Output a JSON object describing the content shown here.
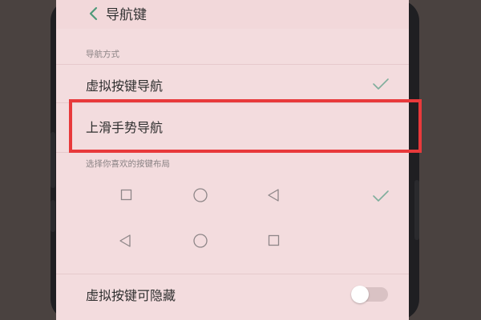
{
  "header": {
    "title": "导航键"
  },
  "nav_mode": {
    "section_label": "导航方式",
    "options": [
      {
        "label": "虚拟按键导航",
        "selected": true
      },
      {
        "label": "上滑手势导航",
        "selected": false
      }
    ]
  },
  "layout": {
    "section_label": "选择你喜欢的按键布局",
    "rows": [
      {
        "keys": [
          "square-icon",
          "circle-icon",
          "back-triangle-icon"
        ],
        "selected": true
      },
      {
        "keys": [
          "back-triangle-icon",
          "circle-icon",
          "square-icon"
        ],
        "selected": false
      }
    ]
  },
  "hide_keys": {
    "label": "虚拟按键可隐藏",
    "enabled": false
  },
  "colors": {
    "accent_check": "#7fae9c",
    "highlight_box": "#e8393b",
    "screen_bg": "#f3dcde"
  }
}
